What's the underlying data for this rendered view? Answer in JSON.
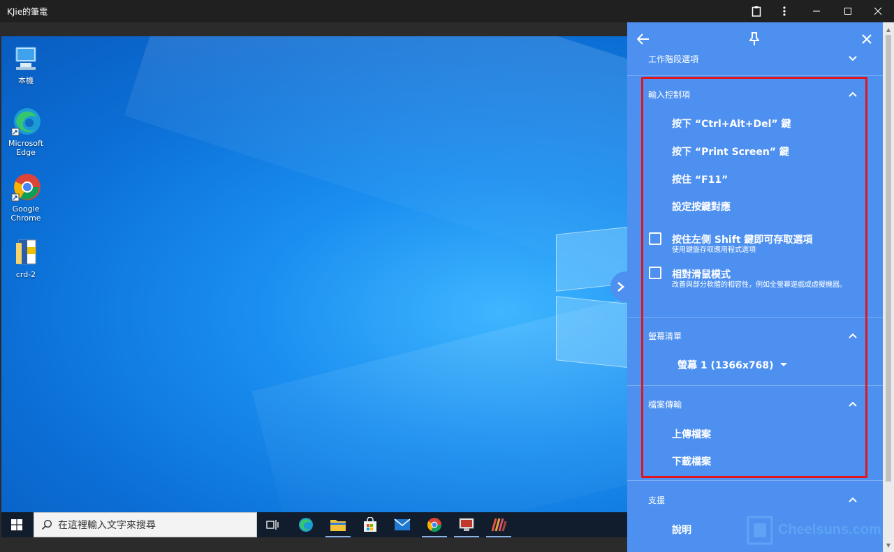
{
  "window": {
    "title": "KJie的筆電",
    "controls": [
      "clipboard-icon",
      "more-vert-icon",
      "minimize-icon",
      "maximize-icon",
      "close-icon"
    ]
  },
  "desktop": {
    "icons": [
      {
        "label": "本機",
        "icon": "computer-icon"
      },
      {
        "label": "Microsoft Edge",
        "icon": "edge-icon"
      },
      {
        "label": "Google Chrome",
        "icon": "chrome-icon"
      },
      {
        "label": "crd-2",
        "icon": "file-icon"
      }
    ]
  },
  "taskbar": {
    "search_placeholder": "在這裡輸入文字來搜尋",
    "apps": [
      "task-view-icon",
      "edge-icon",
      "file-explorer-icon",
      "store-icon",
      "mail-icon",
      "chrome-icon",
      "remote-desktop-icon",
      "app-icon"
    ]
  },
  "panel": {
    "header_icons": [
      "back-arrow-icon",
      "pin-icon",
      "close-icon"
    ],
    "sections": {
      "session": {
        "title": "工作階段選項",
        "expanded": false
      },
      "input": {
        "title": "輸入控制項",
        "expanded": true,
        "actions": [
          "按下 “Ctrl+Alt+Del” 鍵",
          "按下 “Print Screen” 鍵",
          "按住 “F11”",
          "設定按鍵對應"
        ],
        "options": [
          {
            "label": "按住左側 Shift 鍵即可存取選項",
            "desc": "使用鍵盤存取應用程式選項",
            "checked": false
          },
          {
            "label": "相對滑鼠模式",
            "desc": "改善與部分軟體的相容性，例如全螢幕遊戲或虛擬機器。",
            "checked": false
          }
        ]
      },
      "displays": {
        "title": "螢幕清單",
        "expanded": true,
        "selected": "螢幕 1 (1366x768)"
      },
      "files": {
        "title": "檔案傳輸",
        "expanded": true,
        "actions": [
          "上傳檔案",
          "下載檔案"
        ]
      },
      "support": {
        "title": "支援",
        "expanded": true,
        "actions": [
          "說明"
        ]
      }
    }
  },
  "watermark": "Cheelsuns.com",
  "colors": {
    "panel": "#4d90f0",
    "highlight": "#e0161f",
    "titlebar": "#202020"
  }
}
